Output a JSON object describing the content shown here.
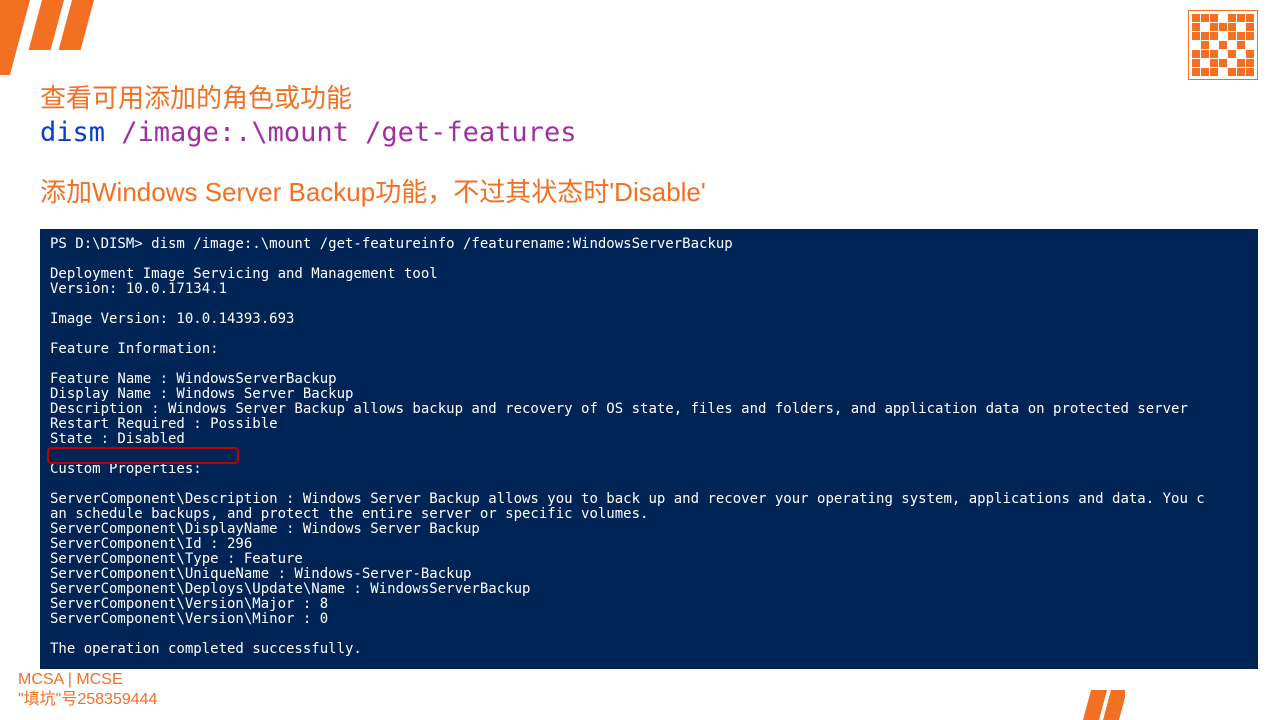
{
  "headings": {
    "title1": "查看可用添加的角色或功能",
    "title2": "添加Windows Server Backup功能，不过其状态时'Disable'"
  },
  "command": {
    "dism": "dism",
    "image_arg": " /image:.\\mount",
    "flag": " /get-features"
  },
  "terminal": {
    "prompt_line": "PS D:\\DISM> dism /image:.\\mount /get-featureinfo /featurename:WindowsServerBackup",
    "tool_name": "Deployment Image Servicing and Management tool",
    "tool_version": "Version: 10.0.17134.1",
    "image_version": "Image Version: 10.0.14393.693",
    "feature_info_header": "Feature Information:",
    "feature_name": "Feature Name : WindowsServerBackup",
    "display_name": "Display Name : Windows Server Backup",
    "description": "Description : Windows Server Backup allows backup and recovery of OS state, files and folders, and application data on protected server",
    "restart": "Restart Required : Possible",
    "state": "State : Disabled",
    "custom_props": "Custom Properties:",
    "sc_desc": "ServerComponent\\Description : Windows Server Backup allows you to back up and recover your operating system, applications and data. You c\nan schedule backups, and protect the entire server or specific volumes.",
    "sc_display": "ServerComponent\\DisplayName : Windows Server Backup",
    "sc_id": "ServerComponent\\Id : 296",
    "sc_type": "ServerComponent\\Type : Feature",
    "sc_unique": "ServerComponent\\UniqueName : Windows-Server-Backup",
    "sc_deploys": "ServerComponent\\Deploys\\Update\\Name : WindowsServerBackup",
    "sc_major": "ServerComponent\\Version\\Major : 8",
    "sc_minor": "ServerComponent\\Version\\Minor : 0",
    "success": "The operation completed successfully."
  },
  "footer": {
    "line1": "MCSA | MCSE",
    "line2": "\"填坑\"号258359444"
  }
}
